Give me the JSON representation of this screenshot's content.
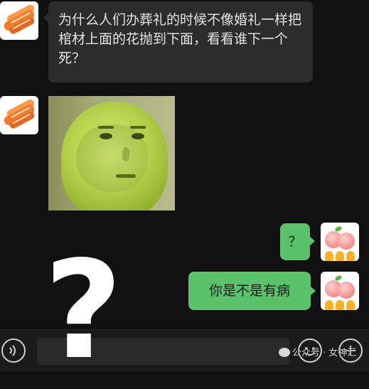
{
  "messages": [
    {
      "sender": "other",
      "type": "text",
      "text": "为什么人们办葬礼的时候不像婚礼一样把棺材上面的花抛到下面，看看谁下一个死？"
    },
    {
      "sender": "other",
      "type": "sticker",
      "description": "pear-face-meme"
    },
    {
      "sender": "me",
      "type": "text",
      "text": "？"
    },
    {
      "sender": "me",
      "type": "text",
      "text": "你是不是有病"
    }
  ],
  "overlay": {
    "question_mark": "?"
  },
  "input_bar": {
    "voice_icon": "voice-icon",
    "emoji_icon": "emoji-icon",
    "plus_icon": "plus-icon"
  },
  "watermark": {
    "text": "公众号 · 女神汇"
  },
  "colors": {
    "background": "#111111",
    "incoming_bubble": "#2c2c2c",
    "outgoing_bubble": "#5ac26b"
  }
}
